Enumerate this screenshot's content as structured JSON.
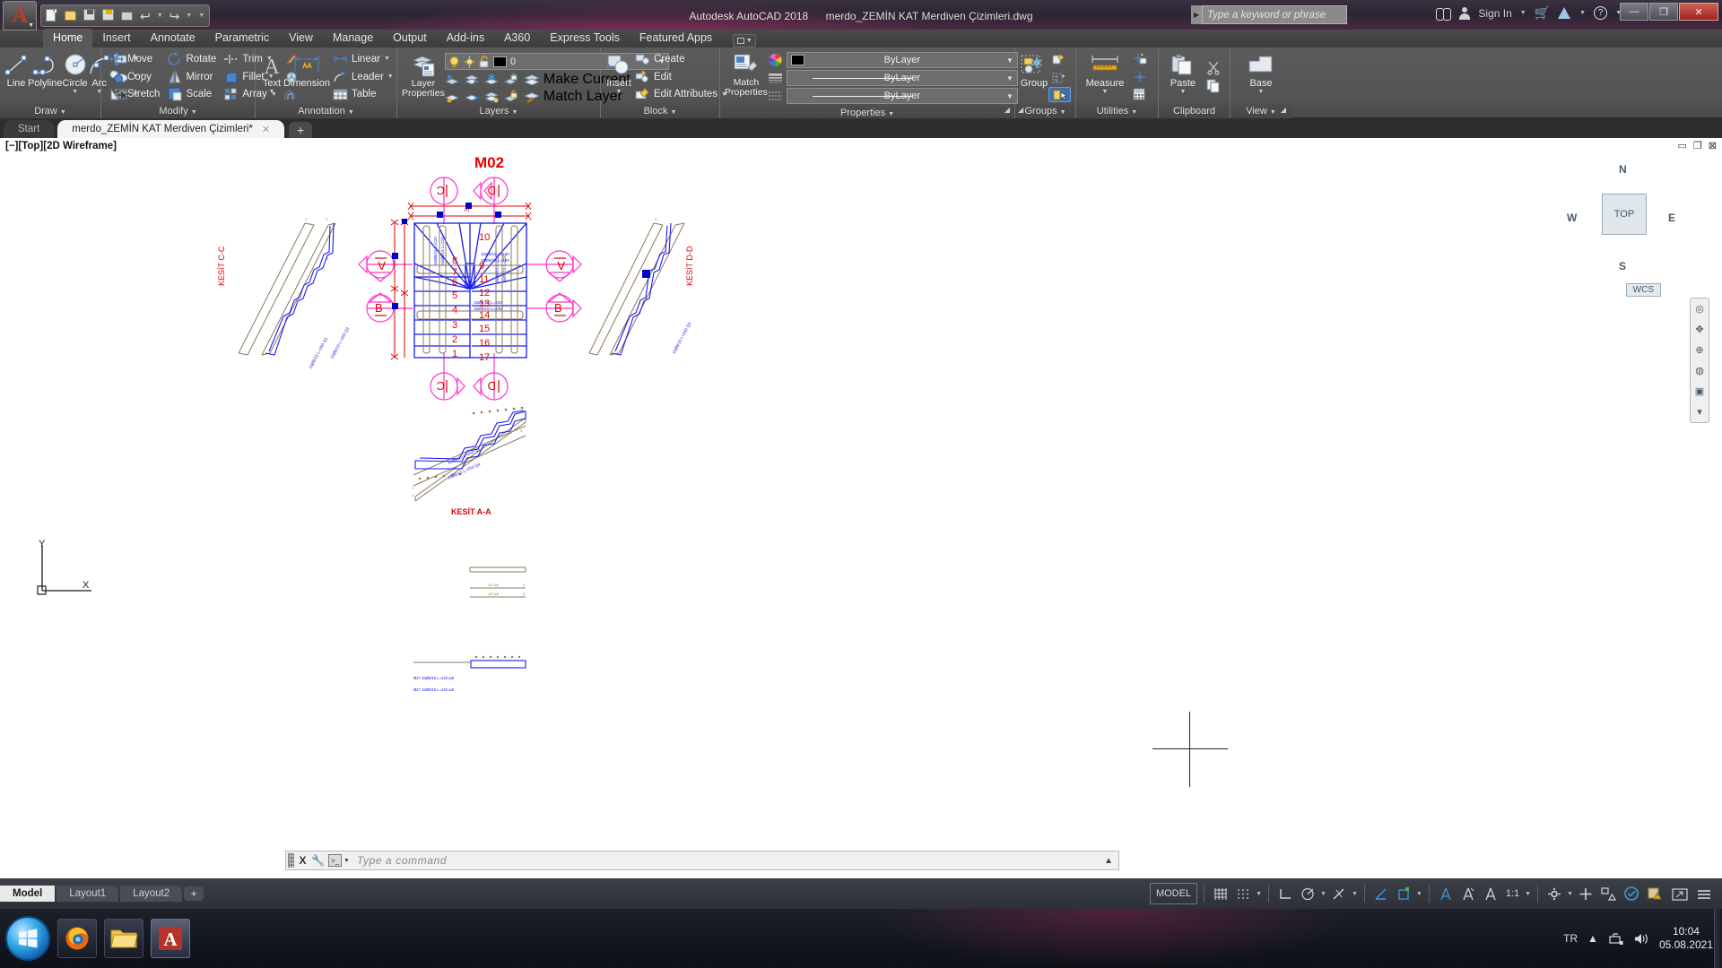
{
  "titlebar": {
    "app_title": "Autodesk AutoCAD 2018",
    "doc_title": "merdo_ZEMİN KAT Merdiven Çizimleri.dwg",
    "search_placeholder": "Type a keyword or phrase",
    "sign_in": "Sign In",
    "quick_access": [
      "new-icon",
      "open-icon",
      "save-icon",
      "save-as-icon",
      "plot-icon",
      "undo-icon",
      "redo-icon",
      "customize-icon"
    ],
    "window_buttons": {
      "minimize": "—",
      "maximize": "❐",
      "close": "✕"
    }
  },
  "ribbon": {
    "tabs": [
      "Home",
      "Insert",
      "Annotate",
      "Parametric",
      "View",
      "Manage",
      "Output",
      "Add-ins",
      "A360",
      "Express Tools",
      "Featured Apps"
    ],
    "active_tab": "Home",
    "panels": [
      {
        "title": "Draw",
        "big_buttons": [
          {
            "label": "Line",
            "icon": "line-icon",
            "caret": false
          },
          {
            "label": "Polyline",
            "icon": "polyline-icon",
            "caret": false
          },
          {
            "label": "Circle",
            "icon": "circle-icon",
            "caret": true
          },
          {
            "label": "Arc",
            "icon": "arc-icon",
            "caret": true
          }
        ],
        "stack_icons": [
          "rectangle-icon",
          "ellipse-icon",
          "hatch-icon"
        ]
      },
      {
        "title": "Modify",
        "items": [
          {
            "label": "Move",
            "icon": "move-icon",
            "caret": false
          },
          {
            "label": "Rotate",
            "icon": "rotate-icon",
            "caret": false
          },
          {
            "label": "Trim",
            "icon": "trim-icon",
            "caret": true
          },
          {
            "label": "Copy",
            "icon": "copy-icon",
            "caret": false
          },
          {
            "label": "Mirror",
            "icon": "mirror-icon",
            "caret": false
          },
          {
            "label": "Fillet",
            "icon": "fillet-icon",
            "caret": true
          },
          {
            "label": "Stretch",
            "icon": "stretch-icon",
            "caret": false
          },
          {
            "label": "Scale",
            "icon": "scale-icon",
            "caret": false
          },
          {
            "label": "Array",
            "icon": "array-icon",
            "caret": true
          }
        ],
        "extra_icons": [
          "erase-icon",
          "explode-icon",
          "offset-icon"
        ]
      },
      {
        "title": "Annotation",
        "big_buttons": [
          {
            "label": "Text",
            "icon": "text-icon",
            "caret": true
          },
          {
            "label": "Dimension",
            "icon": "dimension-icon",
            "caret": false
          }
        ],
        "items": [
          {
            "label": "Linear",
            "icon": "linear-dim-icon",
            "caret": true
          },
          {
            "label": "Leader",
            "icon": "leader-icon",
            "caret": true
          },
          {
            "label": "Table",
            "icon": "table-icon",
            "caret": false
          }
        ]
      },
      {
        "title": "Layers",
        "big_buttons": [
          {
            "label": "Layer\nProperties",
            "icon": "layer-properties-icon",
            "caret": false
          }
        ],
        "current_layer": "0",
        "layer_toggles": [
          "lightbulb-icon",
          "sun-icon",
          "unlock-icon"
        ],
        "items": [
          {
            "label": "Make Current",
            "icon": "make-current-icon"
          },
          {
            "label": "Match Layer",
            "icon": "match-layer-icon"
          }
        ],
        "row1_icons": [
          "layer-isolate-icon",
          "layer-unisolate-icon",
          "layer-freeze-icon",
          "layer-lock-icon"
        ],
        "row2_icons": [
          "layer-off-icon",
          "layer-turn-all-on-icon",
          "layer-thaw-icon",
          "layer-unlock-icon"
        ]
      },
      {
        "title": "Block",
        "big_buttons": [
          {
            "label": "Insert",
            "icon": "insert-block-icon",
            "caret": true
          }
        ],
        "items": [
          {
            "label": "Create",
            "icon": "create-block-icon",
            "caret": false
          },
          {
            "label": "Edit",
            "icon": "edit-block-icon",
            "caret": false
          },
          {
            "label": "Edit Attributes",
            "icon": "edit-attributes-icon",
            "caret": true
          }
        ]
      },
      {
        "title": "Properties",
        "big_buttons": [
          {
            "label": "Match\nProperties",
            "icon": "match-properties-icon",
            "caret": false
          }
        ],
        "combos": [
          {
            "value": "ByLayer",
            "icon": "color-wheel-icon",
            "kind": "color"
          },
          {
            "value": "ByLayer",
            "icon": "lineweight-icon",
            "kind": "lineweight"
          },
          {
            "value": "ByLayer",
            "icon": "linetype-icon",
            "kind": "linetype"
          }
        ]
      },
      {
        "title": "Groups",
        "big_buttons": [
          {
            "label": "Group",
            "icon": "group-icon",
            "caret": false
          }
        ],
        "stack_icons": [
          "ungroup-icon",
          "group-edit-icon",
          "group-selection-toggle-icon"
        ]
      },
      {
        "title": "Utilities",
        "big_buttons": [
          {
            "label": "Measure",
            "icon": "measure-icon",
            "caret": true
          }
        ],
        "stack_icons": [
          "quick-select-icon",
          "point-id-icon",
          "calculator-icon"
        ]
      },
      {
        "title": "Clipboard",
        "big_buttons": [
          {
            "label": "Paste",
            "icon": "paste-icon",
            "caret": true
          }
        ],
        "stack_icons": [
          "cut-icon",
          "copy-clip-icon"
        ]
      },
      {
        "title": "View",
        "big_buttons": [
          {
            "label": "Base",
            "icon": "base-view-icon",
            "caret": true
          }
        ]
      }
    ]
  },
  "file_tabs": {
    "items": [
      {
        "label": "Start",
        "active": false,
        "closable": false
      },
      {
        "label": "merdo_ZEMİN KAT Merdiven Çizimleri*",
        "active": true,
        "closable": true
      }
    ],
    "new_tab": "+"
  },
  "viewport": {
    "label": "[−][Top][2D Wireframe]",
    "viewcube": {
      "top": "TOP",
      "north": "N",
      "east": "E",
      "south": "S",
      "west": "W",
      "wcs": "WCS"
    },
    "controls": [
      "minimize-viewport-icon",
      "maximize-viewport-icon",
      "close-viewport-icon"
    ]
  },
  "drawing": {
    "title": "M02",
    "section_labels": [
      "KESİT C-C",
      "KESİT D-D",
      "KESİT A-A"
    ],
    "section_markers": [
      "A",
      "B",
      "C",
      "D"
    ],
    "step_numbers_left": [
      "8",
      "7",
      "6",
      "5",
      "4",
      "3",
      "2",
      "1"
    ],
    "step_numbers_right": [
      "10",
      "9",
      "11",
      "12",
      "13",
      "14",
      "15",
      "16",
      "17"
    ],
    "rebar_notes": [
      "15Ø8/15 L=240",
      "15Ø8/15 L=250",
      "15Ø8/15 L=220",
      "15Ø8/15 L=220"
    ],
    "colors": {
      "plan_blue": "#1a1aee",
      "annotation_red": "#e00000",
      "marker_magenta": "#ff33cc",
      "section_tan": "#8a7a5a",
      "grip_blue": "#0000cc"
    }
  },
  "command_line": {
    "placeholder": "Type a command",
    "close_label": "X",
    "tools_icon": "wrench-icon",
    "prompt_icon": "command-prompt-icon",
    "expand_icon": "chevron-up-icon"
  },
  "statusbar": {
    "layout_tabs": [
      {
        "label": "Model",
        "active": true
      },
      {
        "label": "Layout1",
        "active": false
      },
      {
        "label": "Layout2",
        "active": false
      }
    ],
    "new_layout": "+",
    "space_mode": "MODEL",
    "annotation_scale": "1:1",
    "right_icons": [
      "grid-display-icon",
      "snap-mode-icon",
      "ortho-mode-icon",
      "polar-tracking-icon",
      "object-snap-icon",
      "isometric-drafting-icon",
      "object-snap-tracking-icon",
      "annotation-visibility-icon",
      "autoscale-icon",
      "workspace-switching-icon",
      "hardware-acceleration-icon",
      "isolate-objects-icon",
      "fullscreen-icon",
      "customization-icon"
    ]
  },
  "taskbar": {
    "apps": [
      "start-orb",
      "firefox-icon",
      "file-explorer-icon",
      "autocad-icon"
    ],
    "tray": {
      "language": "TR",
      "icons": [
        "show-hidden-icon",
        "network-icon",
        "volume-icon"
      ]
    },
    "clock": {
      "time": "10:04",
      "date": "05.08.2021"
    }
  }
}
